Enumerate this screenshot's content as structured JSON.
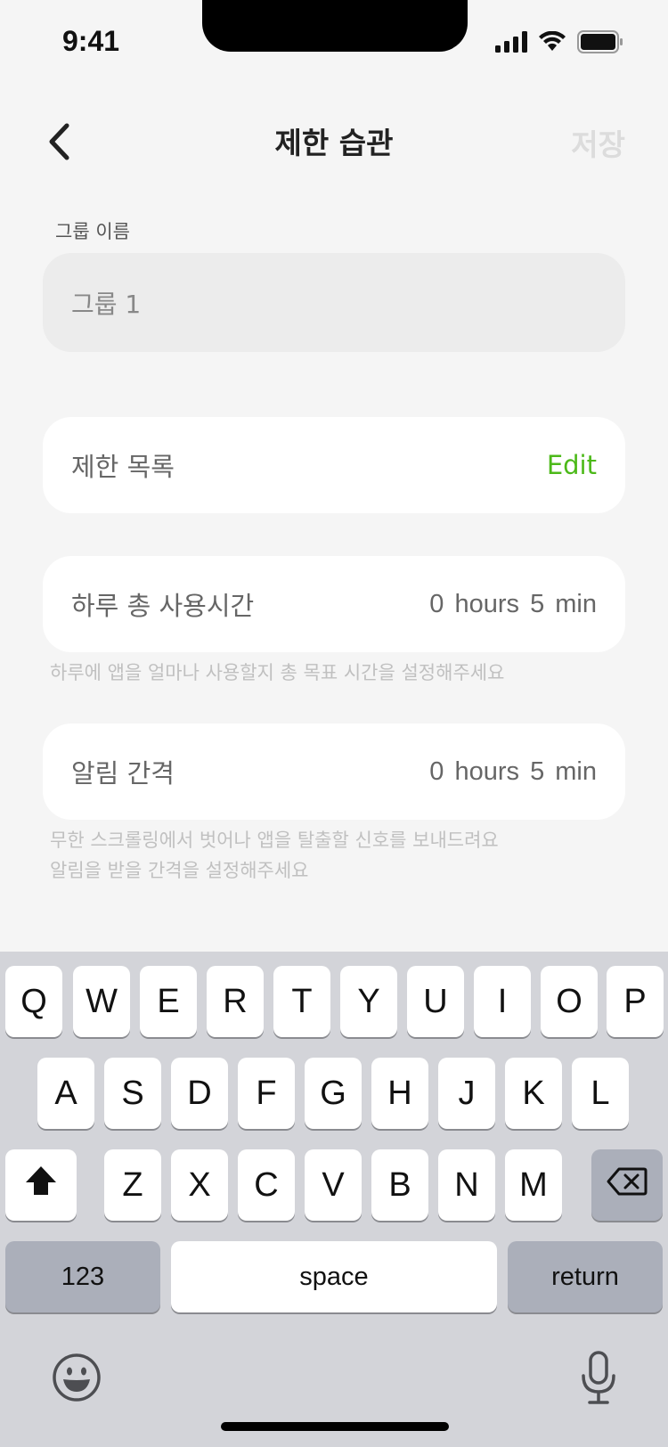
{
  "status_bar": {
    "time": "9:41"
  },
  "nav": {
    "title": "제한 습관",
    "save_label": "저장"
  },
  "group_name": {
    "label": "그룹 이름",
    "value": "그룹 1"
  },
  "restriction_list": {
    "label": "제한 목록",
    "edit_label": "Edit"
  },
  "daily_total": {
    "label": "하루 총 사용시간",
    "value": "0 hours  5 min",
    "hint": "하루에 앱을 얼마나 사용할지 총 목표 시간을 설정해주세요"
  },
  "alert_interval": {
    "label": "알림 간격",
    "value": "0 hours  5 min",
    "hint_line1": "무한 스크롤링에서 벗어나 앱을 탈출할 신호를 보내드려요",
    "hint_line2": "알림을 받을 간격을 설정해주세요"
  },
  "keyboard": {
    "row1": [
      "Q",
      "W",
      "E",
      "R",
      "T",
      "Y",
      "U",
      "I",
      "O",
      "P"
    ],
    "row2": [
      "A",
      "S",
      "D",
      "F",
      "G",
      "H",
      "J",
      "K",
      "L"
    ],
    "row3": [
      "Z",
      "X",
      "C",
      "V",
      "B",
      "N",
      "M"
    ],
    "numbers_label": "123",
    "space_label": "space",
    "return_label": "return",
    "icons": [
      "shift-icon",
      "backspace-icon",
      "emoji-icon",
      "microphone-icon"
    ]
  },
  "colors": {
    "accent": "#4cb919",
    "background": "#f5f5f5",
    "keyboard_bg": "#d3d4d9"
  }
}
